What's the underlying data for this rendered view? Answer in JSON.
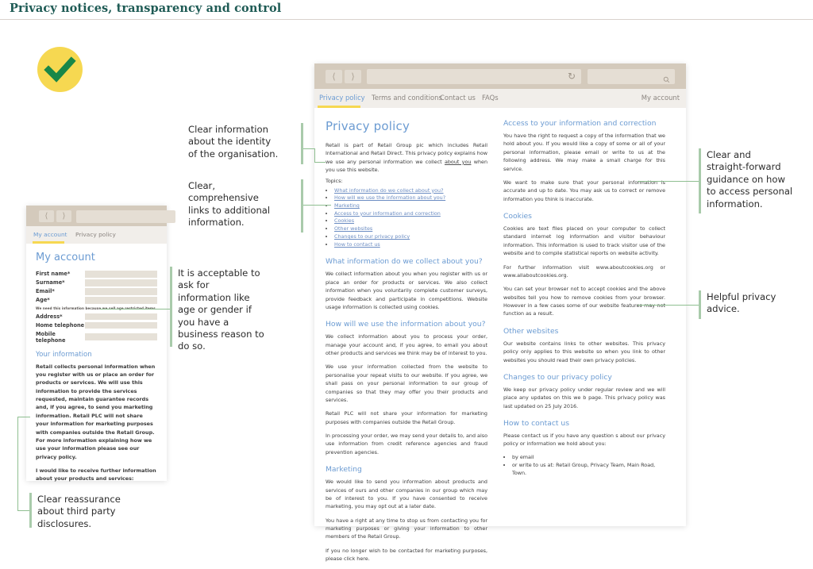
{
  "header": {
    "title": "Privacy notices, transparency and control"
  },
  "badge": {
    "icon": "checkmark-icon",
    "circle_color": "#f6d851",
    "tick_color": "#188748"
  },
  "annotations": [
    {
      "id": "identity",
      "text": "Clear information\nabout the identity\nof the organisation."
    },
    {
      "id": "links",
      "text": "Clear,\ncomprehensive\nlinks to additional\ninformation."
    },
    {
      "id": "age",
      "text": "It is acceptable to\nask for\ninformation like\nage or gender if\nyou have a\nbusiness reason to\ndo so."
    },
    {
      "id": "third-party",
      "text": "Clear reassurance\nabout third party\ndisclosures."
    },
    {
      "id": "access",
      "text": "Clear and\nstraight-forward\nguidance on how\nto access personal\ninformation."
    },
    {
      "id": "advice",
      "text": "Helpful privacy\nadvice."
    }
  ],
  "browser_main": {
    "nav": {
      "back_icon": "chevron-left-icon",
      "forward_icon": "chevron-right-icon",
      "address_value": "",
      "address_placeholder": "",
      "reload_icon": "reload-icon",
      "search_value": "",
      "search_placeholder": "",
      "search_icon": "search-icon"
    },
    "tabs": [
      {
        "label": "Privacy policy",
        "active": true
      },
      {
        "label": "Terms and conditions",
        "active": false
      },
      {
        "label": "Contact us",
        "active": false
      },
      {
        "label": "FAQs",
        "active": false
      }
    ],
    "account_link": "My account",
    "accent_underline": "#f6d851",
    "page": {
      "title": "Privacy policy",
      "intro_a": "Retail is part of Retail Group pic which includes Retail International and Retail Direct. This privacy policy explains how we use any personal information we collect ",
      "intro_underlined": "about you",
      "intro_b": " when you use this website.",
      "topics_label": "Topics:",
      "topics": [
        "What information do we collect about you?",
        "How will we use the information about you?",
        "Marketing",
        "Access to your information and correction",
        "Cookies",
        "Other websites",
        "Changes to our privacy policy",
        "How to contact us"
      ],
      "sections_left": [
        {
          "heading": "What information do we collect about you?",
          "paragraphs": [
            "We collect information about you when you register with us or place an order for products or services. We also collect information when you voluntarily complete customer surveys, provide feedback and participate in competitions. Website usage information is collected using cookies."
          ]
        },
        {
          "heading": "How will we use the information about you?",
          "paragraphs": [
            "We collect information about you to process your order, manage your account and, if you agree, to email you about other products and services we think may be of interest to you.",
            "We use your information collected from the website to personalise your repeat visits to our website. If you agree, we shall pass on your personal information to our group of companies so that they may offer you their products and services.",
            "Retail PLC will not share your information for marketing purposes with companies outside the Retail Group.",
            "In processing your order, we may send your details to, and also use information from credit reference agencies and fraud prevention agencies."
          ]
        },
        {
          "heading": "Marketing",
          "paragraphs": [
            "We would like to send you information about products and services of ours and other companies in our group which may be of interest to you. If you have consented to receive marketing, you may opt out at a later date.",
            "You have a right at any time to stop us from contacting you for marketing purposes or giving your information to other members of the Retail Group."
          ]
        }
      ],
      "marketing_optout_a": "If you no longer wish to be contacted for marketing purposes, please ",
      "marketing_optout_link": "click here",
      "marketing_optout_b": ".",
      "access_heading": "Access to your information and correction",
      "access_p1_a": "You have the right to request a copy of the information that we hold about you. If you would like a copy of some or all of your personal information, please ",
      "access_p1_email": "email",
      "access_p1_b": " or write to us at the following ",
      "access_p1_address": "address",
      "access_p1_c": ". We may make a small charge for this service.",
      "access_p2": "We want to make sure that your personal information is accurate and up to date. You may ask us to correct or remove information you think is inaccurate.",
      "cookies_heading": "Cookies",
      "cookies_p1": "Cookies are text files placed on your computer to collect standard internet log information and visitor behaviour information. This information is used to track visitor use of the website and to compile statistical reports on website activity.",
      "cookies_p2_a": "For further information visit ",
      "cookies_link1": "www.aboutcookies.org",
      "cookies_p2_b": " or ",
      "cookies_link2": "www.allaboutcookies.org",
      "cookies_p2_c": ".",
      "cookies_p3": "You can set your browser not to accept cookies and the above websites tell you how to remove cookies from your browser. However in a few cases some of our website features may not function as a result.",
      "other_heading": "Other websites",
      "other_p1": "Our website contains links to other websites. This privacy policy only applies to this website so when you link to other websites you should read their own privacy policies.",
      "changes_heading": "Changes to our privacy policy",
      "changes_p1": "We keep our privacy policy under regular review and we will place any updates on this we b page. This privacy policy was last updated on 25 July 2016.",
      "contact_heading": "How to contact us",
      "contact_p1": "Please contact us if you have any question s about our privacy policy or information we hold about you:",
      "contact_items_link": "by email",
      "contact_items_text": "or write to us at: Retail Group, Privacy Team, Main Road, Town."
    }
  },
  "browser_account": {
    "nav": {
      "back_icon": "chevron-left-icon",
      "forward_icon": "chevron-right-icon",
      "address_value": "",
      "address_placeholder": ""
    },
    "tabs": [
      {
        "label": "My account",
        "active": true
      },
      {
        "label": "Privacy policy",
        "active": false
      }
    ],
    "accent_underline": "#f6d851",
    "page": {
      "title": "My account",
      "fields": [
        {
          "label": "First name*",
          "value": ""
        },
        {
          "label": "Surname*",
          "value": ""
        },
        {
          "label": "Email*",
          "value": ""
        },
        {
          "label": "Age*",
          "value": ""
        }
      ],
      "age_note": "We need this information because we sell age restricted items.",
      "fields2": [
        {
          "label": "Address*",
          "value": ""
        },
        {
          "label": "Home telephone",
          "value": ""
        },
        {
          "label": "Mobile telephone",
          "value": ""
        }
      ],
      "info_heading": "Your information",
      "info_p1": "Retail collects personal information when you register with us or place an order for products or services. We will use this information to provide the services requested, maintain guarantee records and, if you agree, to send you marketing information. Retail PLC will not share your information for marketing purposes with companies outside the Retail Group. For more information explaining how we use your information please see our privacy policy.",
      "info_p2": "I would like to receive further information about your products and services:"
    }
  }
}
